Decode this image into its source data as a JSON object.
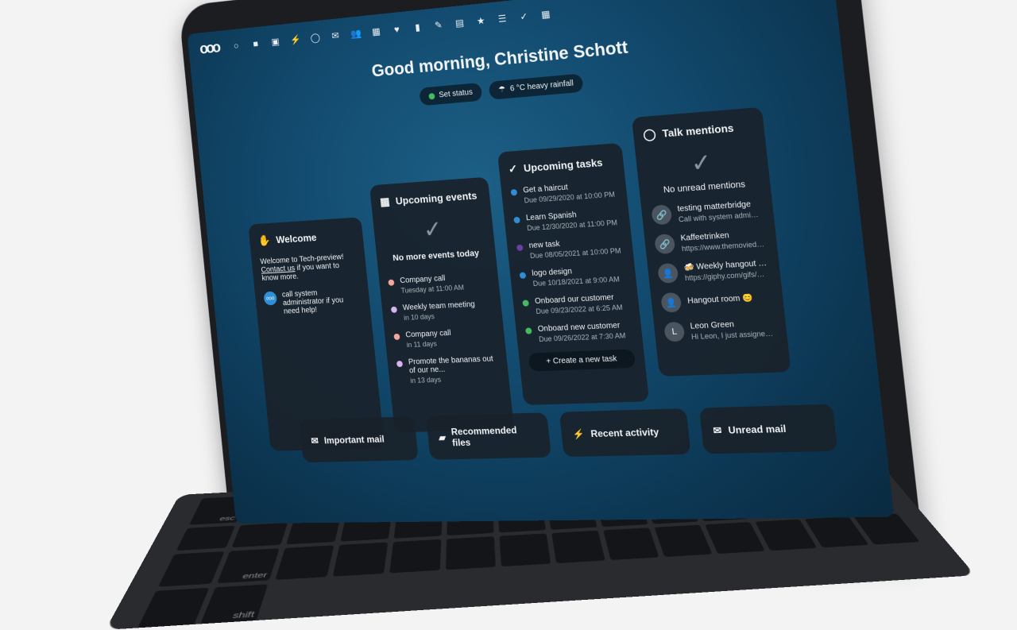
{
  "screen": {
    "logo": "ooo",
    "apps": [
      "○",
      "■",
      "▣",
      "⚡",
      "◯",
      "✉",
      "👥",
      "▦",
      "♥",
      "▮",
      "✎",
      "▤",
      "★",
      "☰",
      "✓",
      "▦"
    ],
    "right_icons": [
      "🔍",
      "🔔",
      "▯"
    ]
  },
  "greeting": "Good morning, Christine Schott",
  "chips": {
    "status": "Set status",
    "weather": "6 °C heavy rainfall"
  },
  "welcome": {
    "title": "Welcome",
    "line1": "Welcome to Tech-preview!",
    "contact_link": "Contact us",
    "contact_rest": " if you want to know more.",
    "note": "call system administrator if you need help!"
  },
  "events": {
    "title": "Upcoming events",
    "empty": "No more events today",
    "items": [
      {
        "name": "Company call",
        "when": "Tuesday at 11:00 AM",
        "color": "#f4a79d"
      },
      {
        "name": "Weekly team meeting",
        "when": "in 10 days",
        "color": "#d8b4f0"
      },
      {
        "name": "Company call",
        "when": "in 11 days",
        "color": "#f4a79d"
      },
      {
        "name": "Promote the bananas out of our ne...",
        "when": "in 13 days",
        "color": "#d8b4f0"
      }
    ]
  },
  "tasks": {
    "title": "Upcoming tasks",
    "create": "Create a new task",
    "items": [
      {
        "name": "Get a haircut",
        "due": "Due 09/29/2020 at 10:00 PM",
        "color": "#2f8fd6"
      },
      {
        "name": "Learn Spanish",
        "due": "Due 12/30/2020 at 11:00 PM",
        "color": "#2f8fd6"
      },
      {
        "name": "new task",
        "due": "Due 08/05/2021 at 10:00 PM",
        "color": "#6b3fa0"
      },
      {
        "name": "logo design",
        "due": "Due 10/18/2021 at 9:00 AM",
        "color": "#2f8fd6"
      },
      {
        "name": "Onboard our customer",
        "due": "Due 09/23/2022 at 6:25 AM",
        "color": "#46ba61"
      },
      {
        "name": "Onboard new customer",
        "due": "Due 09/26/2022 at 7:30 AM",
        "color": "#46ba61"
      }
    ]
  },
  "talk": {
    "title": "Talk mentions",
    "empty": "No unread mentions",
    "items": [
      {
        "name": "testing matterbridge",
        "msg": "Call with system administrator ...",
        "icon": "🔗"
      },
      {
        "name": "Kaffeetrinken",
        "msg": "https://www.themoviedb.org/p...",
        "icon": "🔗"
      },
      {
        "name": "🍻 Weekly hangout 😍",
        "msg": "https://giphy.com/gifs/no-ji6zz...",
        "icon": "👤"
      },
      {
        "name": "Hangout room 😊",
        "msg": "",
        "icon": "👤"
      },
      {
        "name": "Leon Green",
        "msg": "Hi Leon, I just assigned you to t...",
        "icon": "L"
      }
    ]
  },
  "bottom": {
    "important_mail": "Important mail",
    "recommended_files": "Recommended files",
    "recent_activity": "Recent activity",
    "unread_mail": "Unread mail"
  },
  "keyboard": [
    "esc",
    "",
    "",
    "",
    "",
    "",
    "",
    "",
    "",
    "",
    "",
    "",
    "",
    "",
    "",
    "",
    "",
    "",
    "",
    "",
    "",
    "",
    "",
    "",
    "",
    "",
    "",
    "",
    "",
    "enter",
    "",
    "",
    "",
    "",
    "",
    "",
    "",
    "",
    "",
    "",
    "",
    "",
    "",
    "shift"
  ]
}
